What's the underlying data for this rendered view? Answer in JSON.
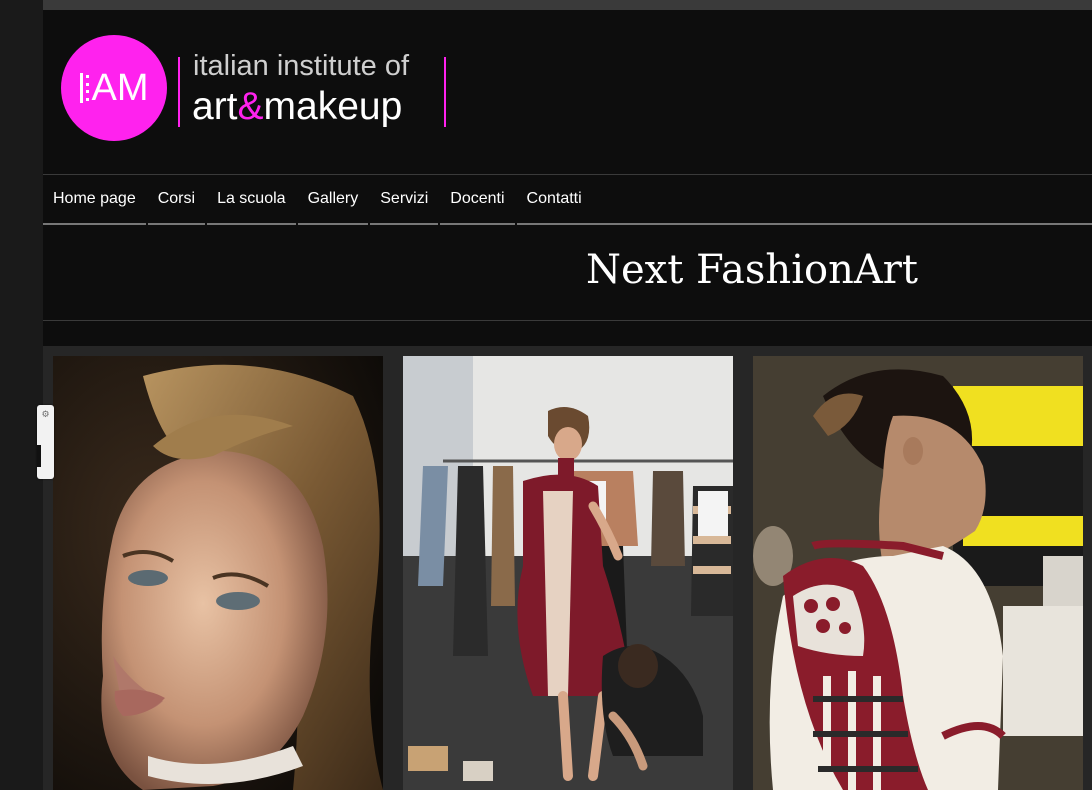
{
  "logo": {
    "mark_text": "AM",
    "line1": "italian institute of",
    "line2_a": "art",
    "line2_amp": "&",
    "line2_b": "makeup",
    "brand_color": "#ff22ee"
  },
  "nav": {
    "items": [
      {
        "label": "Home page"
      },
      {
        "label": "Corsi"
      },
      {
        "label": "La scuola"
      },
      {
        "label": "Gallery"
      },
      {
        "label": "Servizi"
      },
      {
        "label": "Docenti"
      },
      {
        "label": "Contatti"
      }
    ]
  },
  "page": {
    "title": "Next FashionArt"
  },
  "gallery": {
    "images": [
      {
        "subject": "model-portrait-crimped-hair"
      },
      {
        "subject": "backstage-fitting-dress"
      },
      {
        "subject": "model-profile-sleeve"
      }
    ]
  },
  "widget": {
    "icon": "wrench-icon"
  },
  "colors": {
    "background": "#0d0d0d",
    "accent": "#ff22ee",
    "dress_red": "#8a1c2b"
  }
}
